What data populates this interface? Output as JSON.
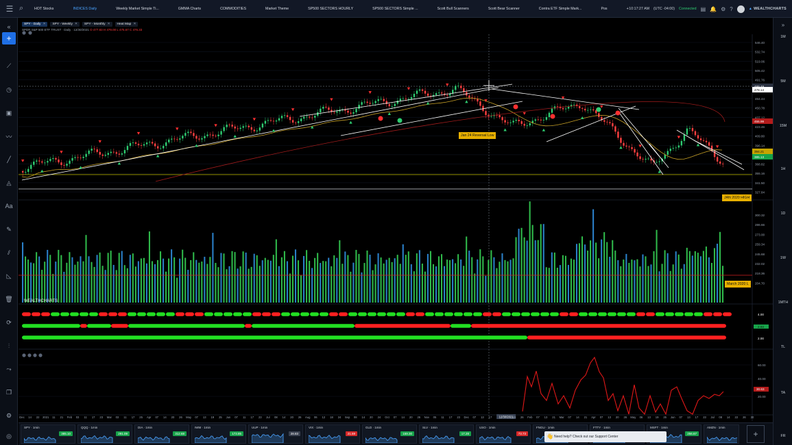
{
  "topbar": {
    "tabs": [
      "HOT Stocks",
      "INDICES Daily",
      "Weekly Market Simple Ti...",
      "GMMA Charts",
      "COMMODITIES",
      "Market Theme",
      "SP500 SECTORS HOURLY",
      "SP500 SECTORS Simple ...",
      "Scott Bull Scanners",
      "Scott Bear Scanner",
      "Contra ETF Simple Mark...",
      "Pos"
    ],
    "active_tab": "INDICES Daily",
    "add_tab": "+",
    "time": "10:17:27 AM",
    "tz": "(UTC -04:00)",
    "status": "Connected",
    "brand": "WEALTHCHARTS"
  },
  "chart_tabs": [
    {
      "label": "SPY - Daily",
      "active": true
    },
    {
      "label": "SPY - Weekly",
      "active": false
    },
    {
      "label": "SPY - Monthly",
      "active": false
    },
    {
      "label": "Heat Map",
      "active": false
    }
  ],
  "legend": {
    "symbol": "SPDR S&P 500 ETF TRUST",
    "interval": "Daily",
    "date": "12/30/2021",
    "ohlc": "O 477.83 H 479.00 L 475.67 C 476.33"
  },
  "left_sidebar": [
    {
      "icon": "collapse-icon",
      "glyph": "«"
    },
    {
      "icon": "add-icon",
      "glyph": "+"
    },
    {
      "icon": "crosshair-line-icon",
      "glyph": "⟋"
    },
    {
      "icon": "clock-icon",
      "glyph": "◷"
    },
    {
      "icon": "calendar-icon",
      "glyph": "▣"
    },
    {
      "icon": "trend-icon",
      "glyph": "〰"
    },
    {
      "icon": "line-tool-icon",
      "glyph": "╱"
    },
    {
      "icon": "shapes-icon",
      "glyph": "◬"
    },
    {
      "icon": "text-icon",
      "glyph": "Aa"
    },
    {
      "icon": "pen-icon",
      "glyph": "✎"
    },
    {
      "icon": "ruler-icon",
      "glyph": "⫽"
    },
    {
      "icon": "measure-icon",
      "glyph": "◺"
    },
    {
      "icon": "trash-icon",
      "glyph": "🗑"
    },
    {
      "icon": "refresh-icon",
      "glyph": "⟳"
    },
    {
      "icon": "chart-icon",
      "glyph": "⫶"
    },
    {
      "icon": "path-icon",
      "glyph": "⤳"
    },
    {
      "icon": "copy-icon",
      "glyph": "❐"
    },
    {
      "icon": "settings-icon",
      "glyph": "⚙"
    },
    {
      "icon": "globe-icon",
      "glyph": "◎"
    }
  ],
  "right_sidebar": {
    "collapse": "»",
    "timeframes": [
      "1M",
      "5M",
      "15M",
      "1H",
      "1D",
      "1W",
      "1MTH",
      "TL",
      "TA",
      "FR"
    ]
  },
  "price_axis": [
    "546.40",
    "532.74",
    "519.06",
    "505.42",
    "491.76",
    "478.10",
    "464.44",
    "450.78",
    "437.12",
    "423.46",
    "409.80",
    "396.14",
    "382.48",
    "368.82",
    "355.16",
    "341.50",
    "327.84"
  ],
  "price_tags": {
    "crosshair": "489.49",
    "hi_tag": "478.14",
    "red_tag": "455.99",
    "yellow_tag": "394.21",
    "close_tag": "385.13"
  },
  "volume_axis": [
    "300.32",
    "286.66",
    "273.00",
    "259.34",
    "245.68",
    "232.02",
    "218.36",
    "204.70"
  ],
  "indicator_axis": [
    "4.00",
    "2.93",
    "2.00"
  ],
  "lower_axis": [
    "60.00",
    "40.00",
    "20.00"
  ],
  "lower_axis_tag": "30.63",
  "annotations": {
    "reversal": "Jan 24 Reversal Low",
    "jan_high": "JAN 2020 HIGH",
    "march_low": "March 2020 L"
  },
  "date_axis": [
    "Dec",
    "14",
    "22",
    "2021",
    "11",
    "21",
    "Feb",
    "03",
    "11",
    "17",
    "23",
    "Mar",
    "03",
    "11",
    "17",
    "25",
    "Apr",
    "07",
    "14",
    "20",
    "26",
    "May",
    "07",
    "13",
    "19",
    "25",
    "Jun",
    "07",
    "11",
    "17",
    "23",
    "Jul",
    "08",
    "14",
    "20",
    "26",
    "Aug",
    "06",
    "12",
    "18",
    "24",
    "Sep",
    "08",
    "14",
    "20",
    "24",
    "Oct",
    "07",
    "14",
    "20",
    "26",
    "Nov",
    "05",
    "11",
    "17",
    "23",
    "Dec",
    "07",
    "13",
    "17",
    "23",
    "12/30/2021",
    "19",
    "26",
    "Feb",
    "07",
    "13",
    "21",
    "Mar",
    "07",
    "14",
    "21",
    "Apr",
    "07",
    "13",
    "20",
    "26",
    "May",
    "06",
    "13",
    "19",
    "25",
    "Jun",
    "07",
    "13",
    "17",
    "23",
    "Jul",
    "08",
    "14",
    "22",
    "26",
    "30"
  ],
  "cursor_date": "12/30/2021",
  "watermark": "WEALTHCHARTS",
  "minis": [
    {
      "name": "SPY · 1min",
      "price": "385.10",
      "color": "#17a34a"
    },
    {
      "name": "QQQ · 1min",
      "price": "291.09",
      "color": "#17a34a"
    },
    {
      "name": "DIA · 1min",
      "price": "312.68",
      "color": "#17a34a"
    },
    {
      "name": "IWM · 1min",
      "price": "173.85",
      "color": "#17a34a"
    },
    {
      "name": "UUP · 1min",
      "price": "28.83",
      "color": "#3a4150"
    },
    {
      "name": "VIX · 1min",
      "price": "21.59",
      "color": "#d62828"
    },
    {
      "name": "GLD · 1min",
      "price": "159.30",
      "color": "#17a34a"
    },
    {
      "name": "SLV · 1min",
      "price": "17.28",
      "color": "#17a34a"
    },
    {
      "name": "USO · 1min",
      "price": "73.73",
      "color": "#d62828"
    },
    {
      "name": "FNGU · 1min",
      "price": "5.86",
      "color": "#17a34a"
    },
    {
      "name": "FTTY · 1min",
      "price": "6.98",
      "color": "#17a34a"
    },
    {
      "name": "MSFT · 1min",
      "price": "256.67",
      "color": "#17a34a"
    },
    {
      "name": "AMZN · 1min",
      "price": "",
      "color": "#17a34a"
    }
  ],
  "help": "Need help? Check out our Support Center",
  "add_widget": "+"
}
